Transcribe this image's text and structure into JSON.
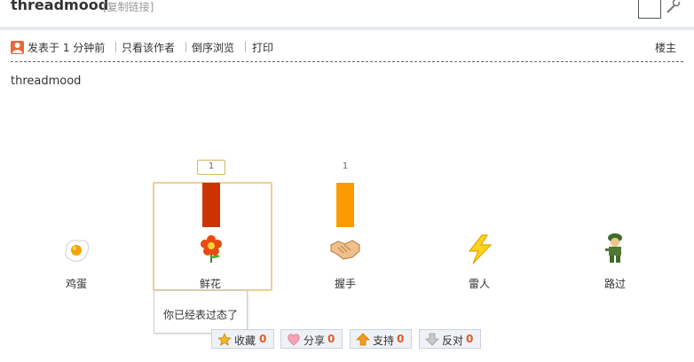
{
  "header": {
    "title": "threadmood",
    "copy_link": "[复制链接]"
  },
  "meta": {
    "posted": "发表于 1 分钟前",
    "only_author": "只看该作者",
    "reverse": "倒序浏览",
    "print": "打印",
    "floor": "楼主"
  },
  "post": {
    "body": "threadmood"
  },
  "reactions": [
    {
      "name": "鸡蛋",
      "icon": "fried-egg-icon",
      "count": 0
    },
    {
      "name": "鲜花",
      "icon": "flower-icon",
      "count": 1
    },
    {
      "name": "握手",
      "icon": "handshake-icon",
      "count": 1
    },
    {
      "name": "雷人",
      "icon": "lightning-icon",
      "count": 0
    },
    {
      "name": "路过",
      "icon": "soldier-icon",
      "count": 0
    }
  ],
  "count_labels": {
    "flower": "1",
    "handshake": "1"
  },
  "tooltip": {
    "text": "你已经表过态了"
  },
  "actions": {
    "favorite": {
      "label": "收藏",
      "count": "0"
    },
    "share": {
      "label": "分享",
      "count": "0"
    },
    "support": {
      "label": "支持",
      "count": "0"
    },
    "oppose": {
      "label": "反对",
      "count": "0"
    }
  },
  "colors": {
    "flower_bar": "#cc3300",
    "handshake_bar": "#ff9900",
    "count_accent": "#e05a2b"
  }
}
